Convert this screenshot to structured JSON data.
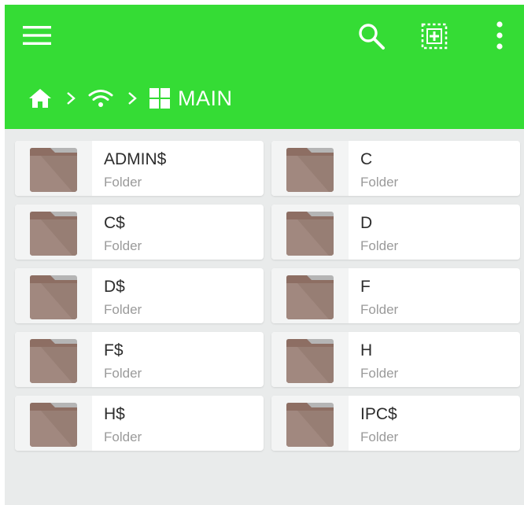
{
  "toolbar": {
    "menu_icon": "hamburger-menu-icon",
    "search_icon": "search-icon",
    "select_icon": "add-select-icon",
    "overflow_icon": "more-vertical-icon",
    "accent_color": "#35dc35"
  },
  "breadcrumb": {
    "home_icon": "home-icon",
    "network_icon": "wifi-icon",
    "share_icon": "windows-icon",
    "current": "MAIN"
  },
  "items": [
    {
      "name": "ADMIN$",
      "type": "Folder"
    },
    {
      "name": "C",
      "type": "Folder"
    },
    {
      "name": "C$",
      "type": "Folder"
    },
    {
      "name": "D",
      "type": "Folder"
    },
    {
      "name": "D$",
      "type": "Folder"
    },
    {
      "name": "F",
      "type": "Folder"
    },
    {
      "name": "F$",
      "type": "Folder"
    },
    {
      "name": "H",
      "type": "Folder"
    },
    {
      "name": "H$",
      "type": "Folder"
    },
    {
      "name": "IPC$",
      "type": "Folder"
    }
  ]
}
